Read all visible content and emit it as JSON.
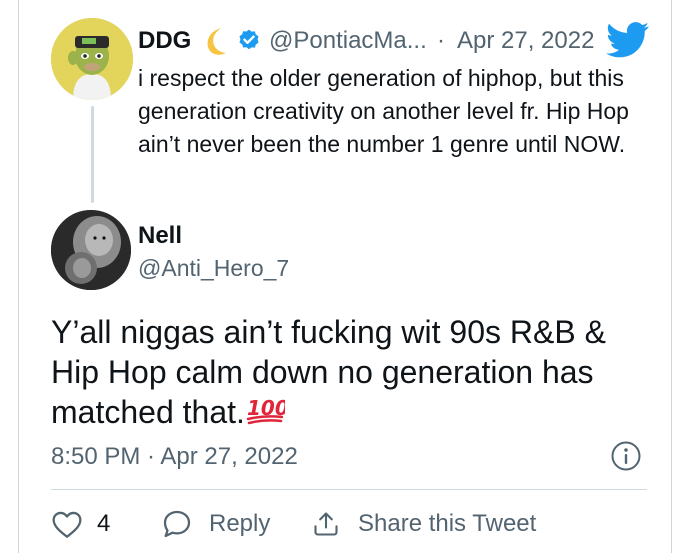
{
  "quoted": {
    "name": "DDG",
    "handle": "@PontiacMa...",
    "dot": "·",
    "date": "Apr 27, 2022",
    "text": "i respect the older generation of hiphop, but this generation creativity on another level fr. Hip Hop ain’t never been the number 1 genre until NOW.",
    "icons": {
      "moon": "crescent-moon-emoji",
      "verified": "verified-badge-icon",
      "bird": "twitter-bird-icon"
    }
  },
  "tweet": {
    "name": "Nell",
    "handle": "@Anti_Hero_7",
    "text": "Y’all niggas ain’t fucking wit 90s R&B & Hip Hop calm down no generation has matched that.",
    "emoji": "hundred-points-emoji",
    "time": "8:50 PM · Apr 27, 2022"
  },
  "actions": {
    "like_count": "4",
    "reply_label": "Reply",
    "share_label": "Share this Tweet"
  },
  "colors": {
    "twitter_blue": "#1d9bf0",
    "muted_text": "#536471",
    "primary_text": "#0f1419",
    "hundred_red": "#e0243a"
  }
}
